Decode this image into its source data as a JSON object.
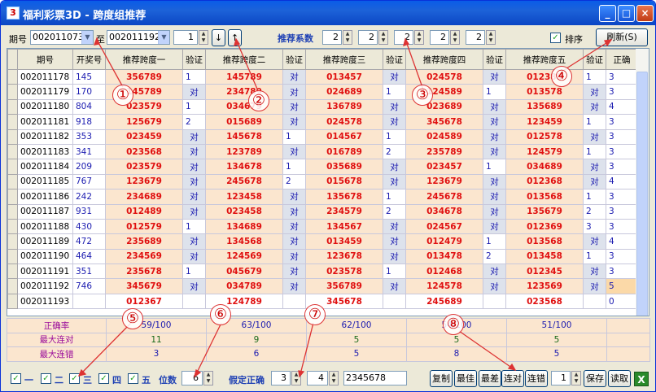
{
  "window": {
    "title": "福利彩票3D - 跨度组推荐",
    "min": "_",
    "max": "□",
    "close": "×",
    "icon": "3"
  },
  "toolbar": {
    "period_label": "期号",
    "period_from": "002011073",
    "to_label": "至",
    "period_to": "002011192",
    "step_value": "1",
    "down_arrow": "↓",
    "up_arrow": "↑",
    "coef_label": "推荐系数",
    "coefs": [
      "2",
      "2",
      "2",
      "2",
      "2"
    ],
    "sort_label": "排序",
    "refresh_label": "刷新(S)"
  },
  "table": {
    "headers": [
      "期号",
      "开奖号",
      "推荐跨度一",
      "验证",
      "推荐跨度二",
      "验证",
      "推荐跨度三",
      "验证",
      "推荐跨度四",
      "验证",
      "推荐跨度五",
      "验证",
      "正确"
    ],
    "rows": [
      [
        "002011178",
        "145",
        "356789",
        "1",
        "145789",
        "对",
        "013457",
        "对",
        "024578",
        "对",
        "012389",
        "1",
        "3"
      ],
      [
        "002011179",
        "170",
        "145789",
        "对",
        "234789",
        "对",
        "024689",
        "1",
        "124589",
        "1",
        "013578",
        "对",
        "3"
      ],
      [
        "002011180",
        "804",
        "023579",
        "1",
        "034679",
        "对",
        "136789",
        "对",
        "023689",
        "对",
        "135689",
        "对",
        "4"
      ],
      [
        "002011181",
        "918",
        "125679",
        "2",
        "015689",
        "对",
        "024578",
        "对",
        "345678",
        "对",
        "123459",
        "1",
        "3"
      ],
      [
        "002011182",
        "353",
        "023459",
        "对",
        "145678",
        "1",
        "014567",
        "1",
        "024589",
        "对",
        "012578",
        "对",
        "3"
      ],
      [
        "002011183",
        "341",
        "023568",
        "对",
        "123789",
        "对",
        "016789",
        "2",
        "235789",
        "对",
        "124579",
        "1",
        "3"
      ],
      [
        "002011184",
        "209",
        "023579",
        "对",
        "134678",
        "1",
        "035689",
        "对",
        "023457",
        "1",
        "034689",
        "对",
        "3"
      ],
      [
        "002011185",
        "767",
        "123679",
        "对",
        "245678",
        "2",
        "015678",
        "对",
        "123679",
        "对",
        "012368",
        "对",
        "4"
      ],
      [
        "002011186",
        "242",
        "234689",
        "对",
        "123458",
        "对",
        "135678",
        "1",
        "245678",
        "对",
        "013568",
        "1",
        "3"
      ],
      [
        "002011187",
        "931",
        "012489",
        "对",
        "023458",
        "对",
        "234579",
        "2",
        "034678",
        "对",
        "135679",
        "2",
        "3"
      ],
      [
        "002011188",
        "430",
        "012579",
        "1",
        "134689",
        "对",
        "134567",
        "对",
        "024567",
        "对",
        "012369",
        "3",
        "3"
      ],
      [
        "002011189",
        "472",
        "235689",
        "对",
        "134568",
        "对",
        "013459",
        "对",
        "012479",
        "1",
        "013568",
        "对",
        "4"
      ],
      [
        "002011190",
        "464",
        "234569",
        "对",
        "124569",
        "对",
        "123678",
        "对",
        "013478",
        "2",
        "013458",
        "1",
        "3"
      ],
      [
        "002011191",
        "351",
        "235678",
        "1",
        "045679",
        "对",
        "023578",
        "1",
        "012468",
        "对",
        "012345",
        "对",
        "3"
      ],
      [
        "002011192",
        "746",
        "345679",
        "对",
        "034789",
        "对",
        "356789",
        "对",
        "124578",
        "对",
        "123569",
        "对",
        "5"
      ],
      [
        "002011193",
        "",
        "012367",
        "",
        "124789",
        "",
        "345678",
        "",
        "245689",
        "",
        "023568",
        "",
        "0"
      ]
    ]
  },
  "summary": {
    "labels": [
      "正确率",
      "最大连对",
      "最大连错"
    ],
    "accuracy": [
      "59/100",
      "63/100",
      "62/100",
      "54/100",
      "51/100"
    ],
    "max_right": [
      "11",
      "9",
      "5",
      "5",
      "5"
    ],
    "max_wrong": [
      "3",
      "6",
      "5",
      "8",
      "5"
    ]
  },
  "bottom": {
    "checks": [
      "一",
      "二",
      "三",
      "四",
      "五"
    ],
    "digits_label": "位数",
    "digits_value": "6",
    "assume_label": "假定正确",
    "assume_a": "3",
    "assume_b": "4",
    "assume_code": "2345678",
    "buttons": [
      "复制",
      "最佳",
      "最差",
      "连对",
      "连错"
    ],
    "page_value": "1",
    "save_label": "保存",
    "read_label": "读取",
    "excel_label": "X"
  },
  "callouts": [
    "①",
    "②",
    "③",
    "④",
    "⑤",
    "⑥",
    "⑦",
    "⑧"
  ],
  "colors": {
    "title_bar": "#0a5ce8",
    "red_value": "#e01010",
    "blue_value": "#1b1bb0",
    "cell_peach": "#fbe6cf",
    "callout": "#cc0000"
  }
}
